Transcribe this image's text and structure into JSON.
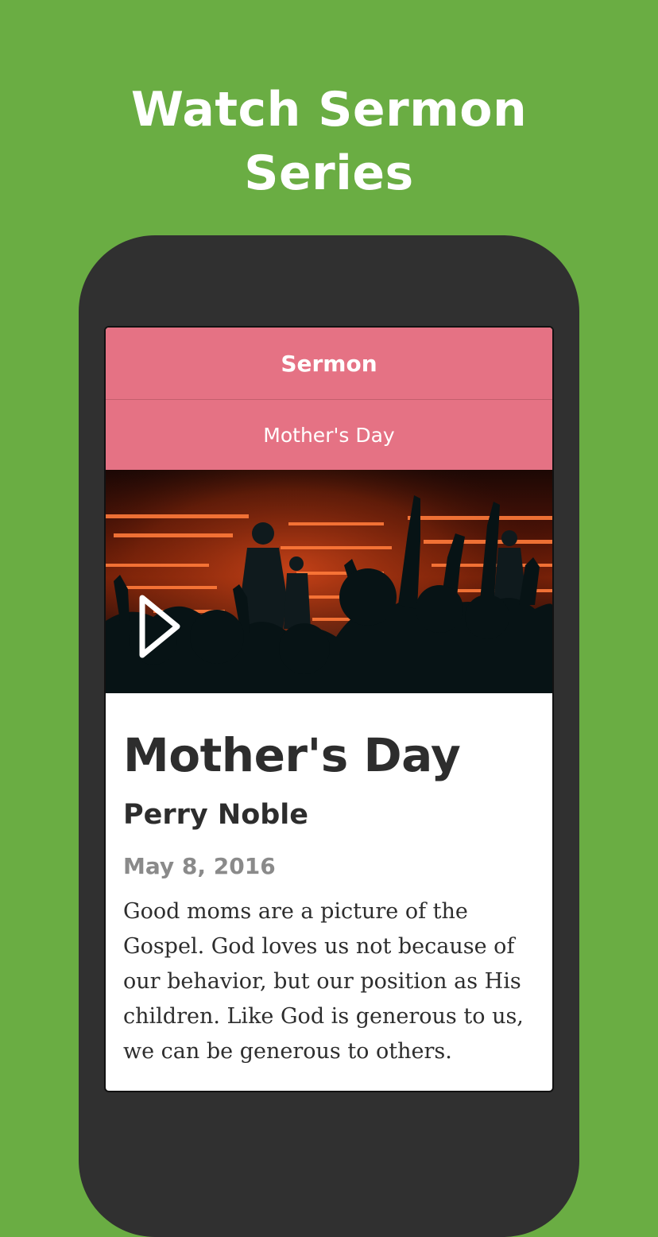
{
  "promo": {
    "headline_line1": "Watch Sermon",
    "headline_line2": "Series",
    "background_color": "#6aad43"
  },
  "screen": {
    "nav_title": "Sermon",
    "series_name": "Mother's Day",
    "accent_color": "#e57284",
    "hero": {
      "icon": "play-icon"
    },
    "sermon": {
      "title": "Mother's Day",
      "speaker": "Perry Noble",
      "date": "May 8, 2016",
      "description": "Good moms are a picture of the Gospel. God loves us not because of our behavior, but our position as His children. Like God is generous to us, we can be generous to others."
    }
  }
}
